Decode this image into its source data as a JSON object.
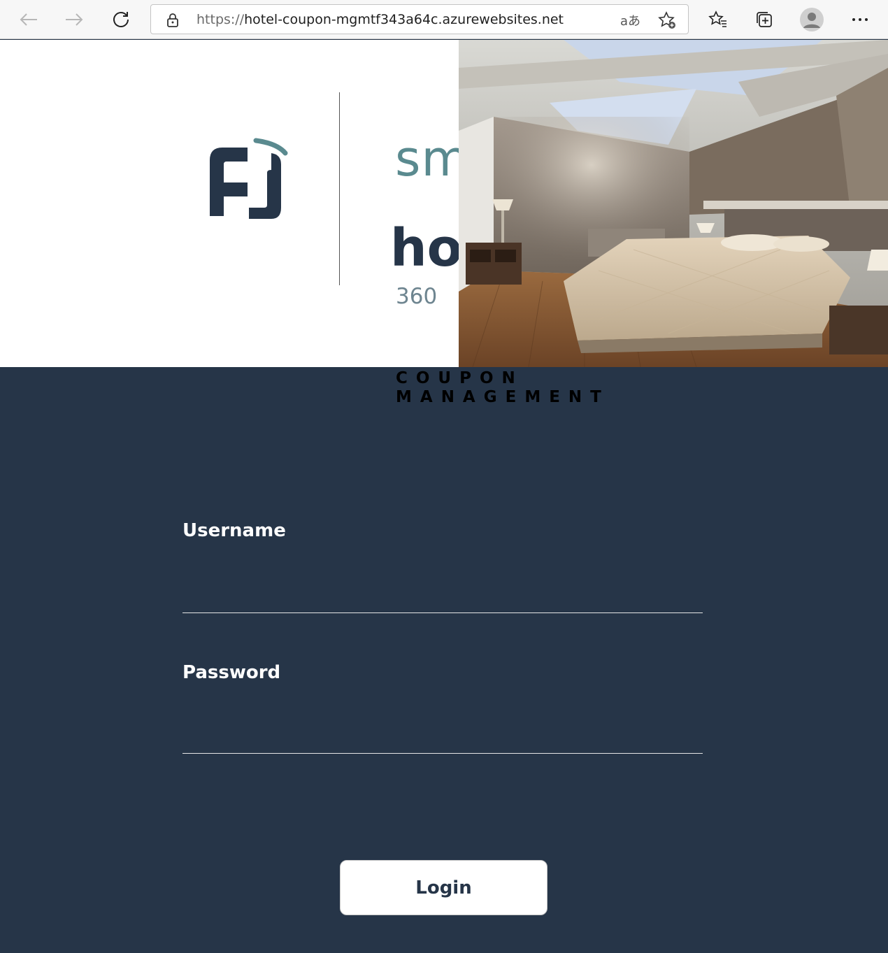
{
  "browser": {
    "url_scheme": "https://",
    "url_host": "hotel-coupon-mgmtf343a64c.azurewebsites.net",
    "read_aloud_label": "aあ",
    "icons": [
      "back-arrow-icon",
      "forward-arrow-icon",
      "refresh-icon",
      "lock-icon",
      "add-favorite-icon",
      "favorites-icon",
      "collections-icon",
      "profile-icon",
      "more-icon"
    ]
  },
  "brand": {
    "line1": "sm",
    "line2": "ho",
    "line3": "360",
    "tagline_line1": "COUPON",
    "tagline_line2": "MANAGEMENT",
    "colors": {
      "teal": "#5a8a8f",
      "navy": "#263548"
    }
  },
  "form": {
    "username_label": "Username",
    "username_value": "",
    "password_label": "Password",
    "password_value": "",
    "login_label": "Login"
  }
}
